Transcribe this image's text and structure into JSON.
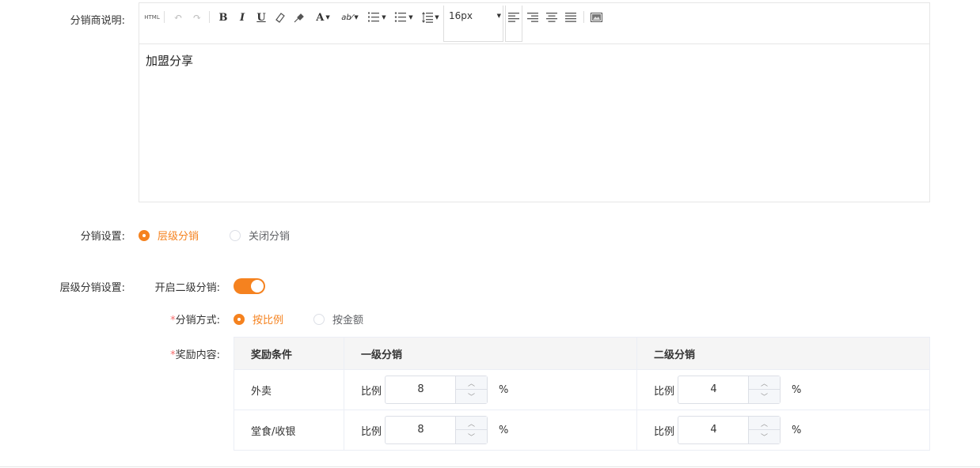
{
  "editor_section": {
    "label": "分销商说明:",
    "toolbar": {
      "html": "HTML",
      "bold": "B",
      "italic": "I",
      "underline": "U",
      "font_color": "A",
      "font_size": "16px"
    },
    "content": "加盟分享"
  },
  "distribution_setting": {
    "label": "分销设置:",
    "options": [
      {
        "label": "层级分销",
        "selected": true
      },
      {
        "label": "关闭分销",
        "selected": false
      }
    ]
  },
  "level_setting": {
    "label": "层级分销设置:",
    "second_level_label": "开启二级分销:",
    "second_level_enabled": true,
    "method": {
      "label": "分销方式:",
      "required_mark": "*",
      "options": [
        {
          "label": "按比例",
          "selected": true
        },
        {
          "label": "按金额",
          "selected": false
        }
      ]
    },
    "reward": {
      "label": "奖励内容:",
      "required_mark": "*",
      "headers": [
        "奖励条件",
        "一级分销",
        "二级分销"
      ],
      "rows": [
        {
          "condition": "外卖",
          "level1_prefix": "比例",
          "level1": "8",
          "level1_unit": "%",
          "level2_prefix": "比例",
          "level2": "4",
          "level2_unit": "%"
        },
        {
          "condition": "堂食/收银",
          "level1_prefix": "比例",
          "level1": "8",
          "level1_unit": "%",
          "level2_prefix": "比例",
          "level2": "4",
          "level2_unit": "%"
        }
      ]
    }
  },
  "colors": {
    "accent": "#f5821f",
    "required": "#f56c6c",
    "border": "#e6e6e6"
  }
}
